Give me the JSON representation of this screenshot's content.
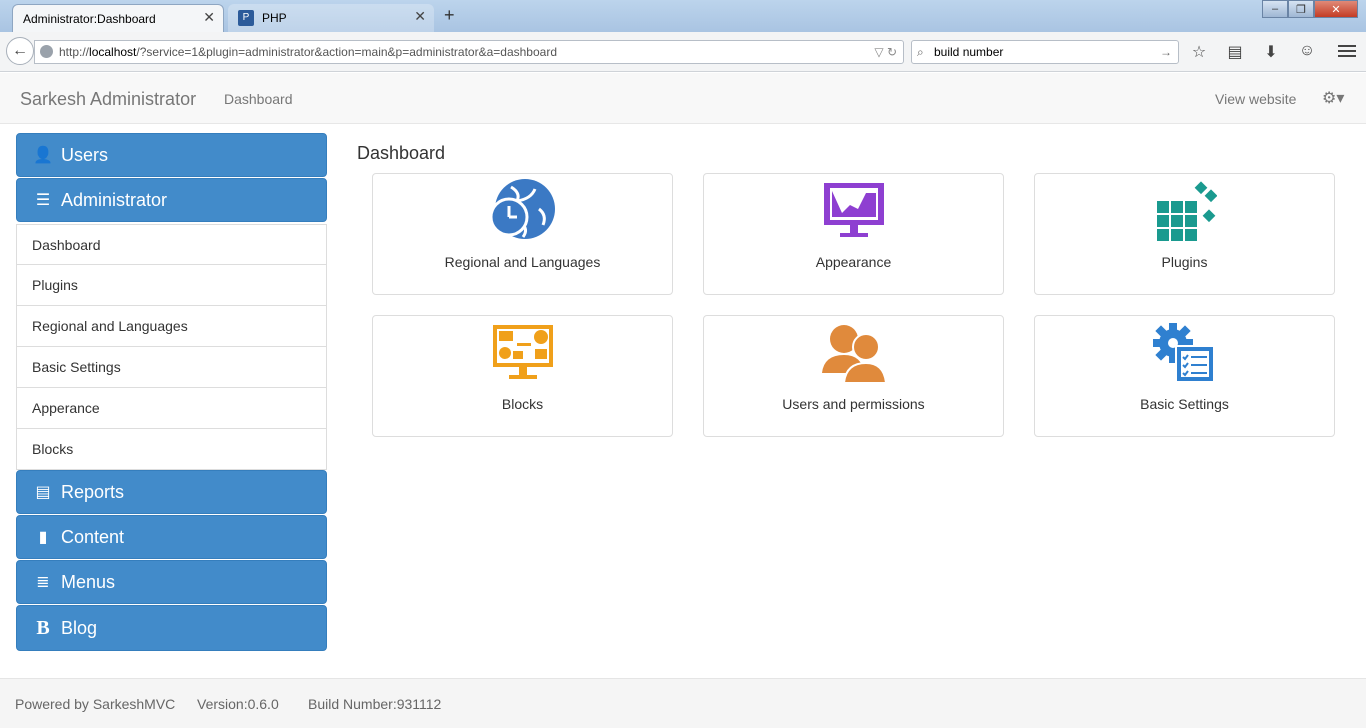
{
  "browser": {
    "tabs": [
      {
        "title": "Administrator:Dashboard",
        "active": true
      },
      {
        "title": "PHP",
        "active": false
      }
    ],
    "url_prefix": "http://",
    "url_host": "localhost",
    "url_path": "/?service=1&plugin=administrator&action=main&p=administrator&a=dashboard",
    "search_value": "build  number"
  },
  "header": {
    "brand": "Sarkesh Administrator",
    "breadcrumb": "Dashboard",
    "view_website": "View website"
  },
  "sidebar": {
    "users": "Users",
    "administrator": "Administrator",
    "submenu": [
      "Dashboard",
      "Plugins",
      "Regional and Languages",
      "Basic Settings",
      "Apperance",
      "Blocks"
    ],
    "reports": "Reports",
    "content": "Content",
    "menus": "Menus",
    "blog": "Blog",
    "blog_icon": "B"
  },
  "main": {
    "title": "Dashboard",
    "cards": [
      {
        "label": "Regional and Languages",
        "icon": "globe-clock-icon",
        "color": "#3b79c4"
      },
      {
        "label": "Appearance",
        "icon": "monitor-chart-icon",
        "color": "#8e3fd1"
      },
      {
        "label": "Plugins",
        "icon": "cubes-icon",
        "color": "#1a9a8f"
      },
      {
        "label": "Blocks",
        "icon": "monitor-blocks-icon",
        "color": "#f0a01a"
      },
      {
        "label": "Users and permissions",
        "icon": "users-icon",
        "color": "#e08a3c"
      },
      {
        "label": "Basic Settings",
        "icon": "settings-list-icon",
        "color": "#2f80d0"
      }
    ]
  },
  "footer": {
    "powered": "Powered by SarkeshMVC",
    "version": "Version:0.6.0",
    "build": "Build Number:931112"
  },
  "colors": {
    "primary": "#428bca"
  }
}
